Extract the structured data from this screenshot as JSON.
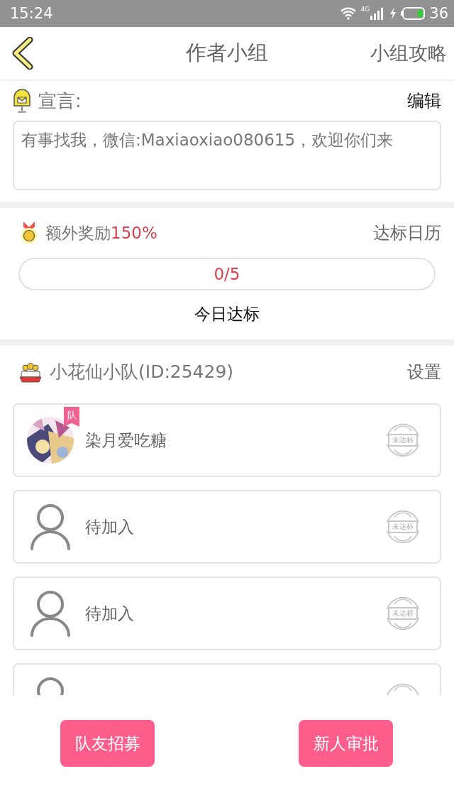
{
  "status_bar": {
    "time": "15:24",
    "network": "4G",
    "battery": "36"
  },
  "nav": {
    "title": "作者小组",
    "action": "小组攻略"
  },
  "declaration": {
    "label": "宣言:",
    "edit": "编辑",
    "value": "有事找我，微信:Maxiaoxiao080615，欢迎你们来"
  },
  "reward": {
    "label": "额外奖励**150%**",
    "calendar": "达标日历",
    "progress": {
      "reading": "0/5",
      "level": 0
    },
    "caption": "今日达标"
  },
  "team": {
    "name": "小花仙小队(ID:25429)",
    "settings": "设置",
    "members": [
      {
        "kind": "member",
        "name": "染月爱吃糖",
        "badge": "队",
        "status": "未达标"
      },
      {
        "kind": "empty",
        "name": "待加入",
        "status": "未达标"
      },
      {
        "kind": "empty",
        "name": "待加入",
        "status": "未达标"
      },
      {
        "kind": "empty"
      }
    ]
  },
  "buttons": [
    "队友招募",
    "新人审批"
  ]
}
